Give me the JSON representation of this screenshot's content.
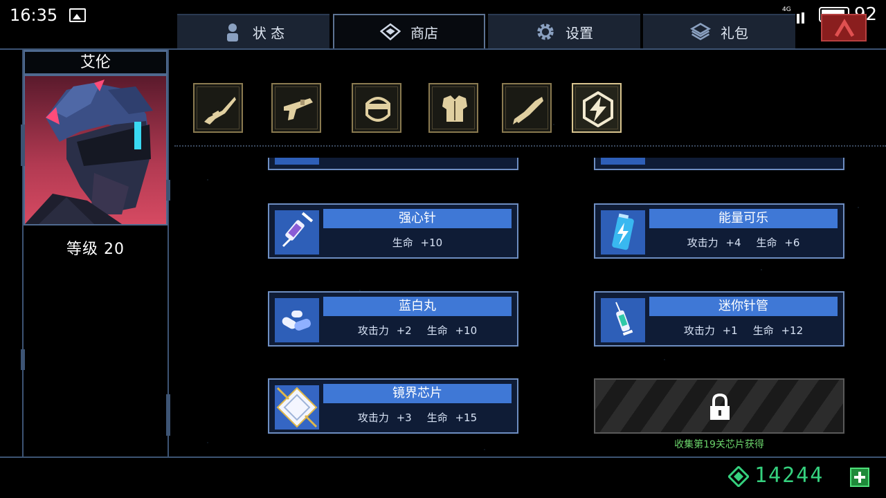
{
  "status_bar": {
    "time": "16:35",
    "network": "4G",
    "battery": "92"
  },
  "tabs": [
    {
      "label": "状 态",
      "icon": "person-icon",
      "active": false
    },
    {
      "label": "商店",
      "icon": "diamond-icon",
      "active": true
    },
    {
      "label": "设置",
      "icon": "gear-icon",
      "active": false
    },
    {
      "label": "礼包",
      "icon": "gift-icon",
      "active": false
    }
  ],
  "character": {
    "name": "艾伦",
    "level": "等级 20"
  },
  "categories": [
    {
      "icon": "rifle-icon"
    },
    {
      "icon": "blaster-icon"
    },
    {
      "icon": "helmet-icon"
    },
    {
      "icon": "armor-icon"
    },
    {
      "icon": "mech-arm-icon"
    },
    {
      "icon": "lightning-chip-icon",
      "active": true
    }
  ],
  "items": [
    {
      "name": "强心针",
      "stats": [
        "生命 +10"
      ],
      "icon": "syringe-icon"
    },
    {
      "name": "能量可乐",
      "stats": [
        "攻击力 +4",
        "生命 +6"
      ],
      "icon": "soda-can-icon"
    },
    {
      "name": "蓝白丸",
      "stats": [
        "攻击力 +2",
        "生命 +10"
      ],
      "icon": "pills-icon"
    },
    {
      "name": "迷你针管",
      "stats": [
        "攻击力 +1",
        "生命 +12"
      ],
      "icon": "mini-syringe-icon"
    },
    {
      "name": "镜界芯片",
      "stats": [
        "攻击力 +3",
        "生命 +15"
      ],
      "icon": "chip-icon"
    }
  ],
  "locked_slot": {
    "note": "收集第19关芯片获得",
    "icon": "lock-icon"
  },
  "currency": {
    "amount": "14244",
    "icon": "gem-icon"
  },
  "colors": {
    "card_bg": "#0f1c36",
    "card_border": "#6e8ec2",
    "name_bar": "#3f78d6",
    "currency": "#35d17e",
    "close": "#8a1e1e"
  }
}
